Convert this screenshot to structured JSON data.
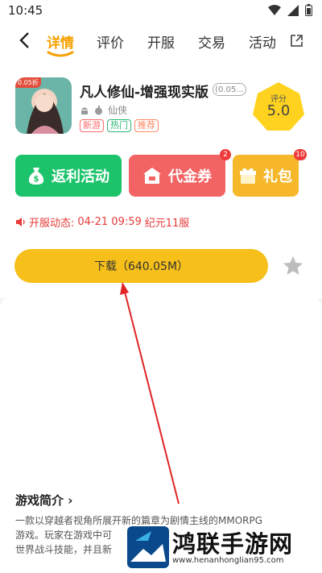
{
  "status": {
    "time": "10:45"
  },
  "nav": {
    "tabs": [
      {
        "label": "详情",
        "active": true
      },
      {
        "label": "评价"
      },
      {
        "label": "开服"
      },
      {
        "label": "交易"
      },
      {
        "label": "活动"
      }
    ]
  },
  "app": {
    "icon_badge": "0.05折",
    "name": "凡人修仙-增强现实版",
    "version_badge": "(0.05...",
    "category": "仙侠",
    "tags": [
      {
        "label": "新游",
        "color": "#ff6b6b"
      },
      {
        "label": "热门",
        "color": "#2bb673"
      },
      {
        "label": "推荐",
        "color": "#ff8a65"
      }
    ],
    "score_label": "评分",
    "score_value": "5.0"
  },
  "actions": [
    {
      "label": "返利活动",
      "color": "#1cc36a",
      "icon": "money-bag-icon"
    },
    {
      "label": "代金券",
      "color": "#f26363",
      "icon": "coupon-icon",
      "badge": "2"
    },
    {
      "label": "礼包",
      "color": "#f6b72a",
      "icon": "gift-icon",
      "badge": "10"
    }
  ],
  "open_info": {
    "label": "开服动态:",
    "time": "04-21 09:59",
    "server": "纪元11服"
  },
  "download": {
    "label": "下载（640.05M）"
  },
  "intro": {
    "title": "游戏简介",
    "line1": "一款以穿越者视角所展开新的篇章为剧情主线的MMORPG",
    "line2": "游戏。玩家在游戏中可",
    "line3": "世界战斗技能，并且新"
  },
  "watermark": {
    "text": "鸿联手游网",
    "url": "www.henanhonglian95.com"
  },
  "colors": {
    "accent": "#f5a100",
    "download": "#f6bf1a",
    "alert": "#e83a3a"
  }
}
